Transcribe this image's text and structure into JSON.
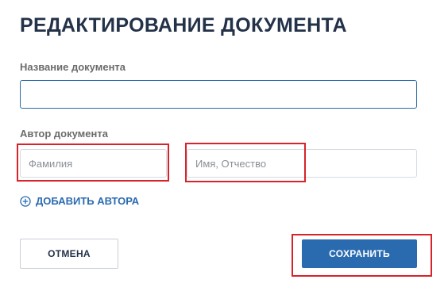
{
  "page": {
    "title": "РЕДАКТИРОВАНИЕ ДОКУМЕНТА"
  },
  "document_name": {
    "label": "Название документа",
    "value": ""
  },
  "author": {
    "label": "Автор документа",
    "last_name_placeholder": "Фамилия",
    "first_name_placeholder": "Имя, Отчество",
    "last_name_value": "",
    "first_name_value": ""
  },
  "add_author": {
    "label": "ДОБАВИТЬ АВТОРА",
    "icon": "plus-circle-icon"
  },
  "actions": {
    "cancel_label": "ОТМЕНА",
    "save_label": "СОХРАНИТЬ"
  },
  "colors": {
    "title": "#233248",
    "accent": "#2a6bb0",
    "highlight": "#d8232a"
  }
}
